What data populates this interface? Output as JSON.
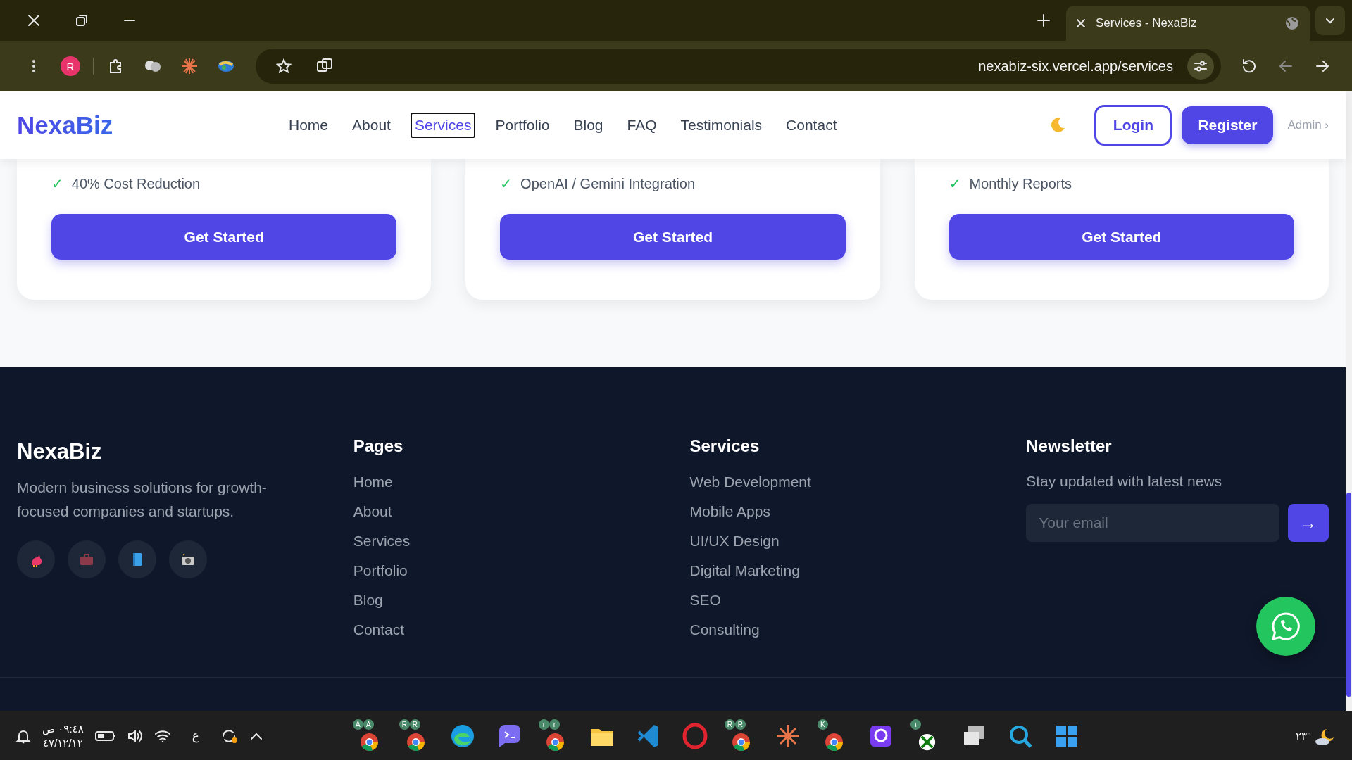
{
  "browser": {
    "tabs": [
      {
        "title": "Services - NexaBiz",
        "selected": true
      }
    ],
    "profile": "R",
    "address": "nexabiz-six.vercel.app/services"
  },
  "navbar": {
    "logo": "NexaBiz",
    "links": [
      {
        "label": "Home",
        "selected": false
      },
      {
        "label": "About",
        "selected": false
      },
      {
        "label": "Services",
        "selected": true
      },
      {
        "label": "Portfolio",
        "selected": false
      },
      {
        "label": "Blog",
        "selected": false
      },
      {
        "label": "FAQ",
        "selected": false
      },
      {
        "label": "Testimonials",
        "selected": false
      },
      {
        "label": "Contact",
        "selected": false
      }
    ],
    "login": "Login",
    "register": "Register",
    "admin": "Admin ›"
  },
  "pricing_cards": [
    {
      "check": "✓",
      "feature": "40% Cost Reduction",
      "button": "Get Started"
    },
    {
      "check": "✓",
      "feature": "OpenAI / Gemini Integration",
      "button": "Get Started"
    },
    {
      "check": "✓",
      "feature": "Monthly Reports",
      "button": "Get Started"
    }
  ],
  "footer": {
    "brand": "NexaBiz",
    "tagline": "Modern business solutions for growth-focused companies and startups.",
    "social": [
      {
        "kind": "bird"
      },
      {
        "kind": "briefcase"
      },
      {
        "kind": "book"
      },
      {
        "kind": "camera"
      }
    ],
    "columns": [
      {
        "heading": "Pages",
        "links": [
          "Home",
          "About",
          "Services",
          "Portfolio",
          "Blog",
          "Contact"
        ]
      },
      {
        "heading": "Services",
        "links": [
          "Web Development",
          "Mobile Apps",
          "UI/UX Design",
          "Digital Marketing",
          "SEO",
          "Consulting"
        ]
      }
    ],
    "newsletter": {
      "heading": "Newsletter",
      "text": "Stay updated with latest news",
      "placeholder": "Your email",
      "button": "→"
    }
  },
  "taskbar": {
    "clock": "٠٩:٤٨ ص",
    "date": "٤٧/١٢/١٢",
    "language": "ع",
    "temperature": "٢٣°",
    "apps": [
      {
        "kind": "chrome",
        "badges": [
          "A",
          "A"
        ]
      },
      {
        "kind": "chrome",
        "badges": [
          "R",
          "R"
        ]
      },
      {
        "kind": "edge"
      },
      {
        "kind": "chat"
      },
      {
        "kind": "chrome",
        "badges": [
          "r",
          "r"
        ]
      },
      {
        "kind": "folder"
      },
      {
        "kind": "code"
      },
      {
        "kind": "opera"
      },
      {
        "kind": "chrome",
        "badges": [
          "R",
          "R"
        ]
      },
      {
        "kind": "star"
      },
      {
        "kind": "chrome",
        "badges": [
          "K"
        ]
      },
      {
        "kind": "square"
      },
      {
        "kind": "xbox",
        "badges": [
          "١"
        ]
      },
      {
        "kind": "stack"
      },
      {
        "kind": "search"
      },
      {
        "kind": "start"
      }
    ]
  }
}
